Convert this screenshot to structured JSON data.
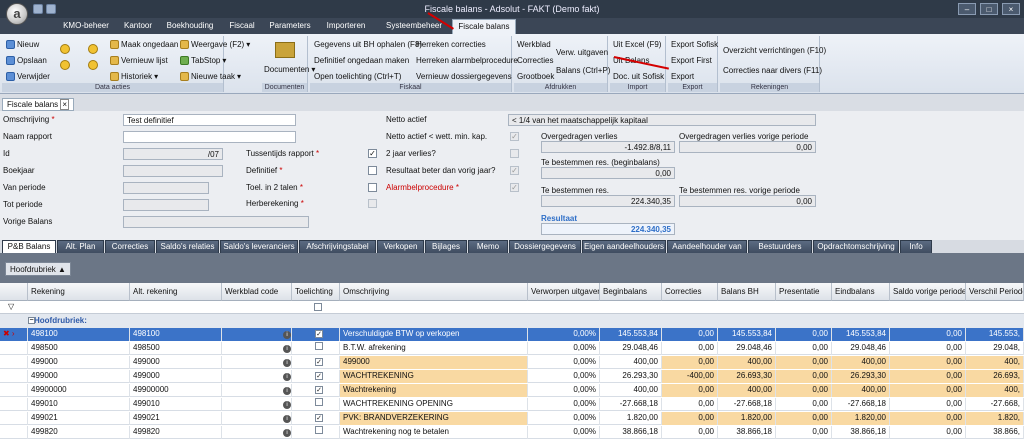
{
  "window": {
    "title": "Fiscale balans - Adsolut - FAKT (Demo fakt)"
  },
  "menu_tabs": [
    "KMO-beheer",
    "Kantoor",
    "Boekhouding",
    "Fiscaal",
    "Parameters",
    "Importeren",
    "Systeembeheer",
    "Fiscale balans"
  ],
  "ribbon": {
    "data_acties": {
      "label": "Data acties",
      "nieuw": "Nieuw",
      "opslaan": "Opslaan",
      "verwijder": "Verwijder",
      "maak_ongedaan": "Maak ongedaan",
      "vernieuw_lijst": "Vernieuw lijst",
      "historiek": "Historiek",
      "weergave": "Weergave (F2)",
      "tabstop": "TabStop",
      "nieuwe_taak": "Nieuwe taak"
    },
    "documenten": {
      "label": "Documenten",
      "btn": "Documenten"
    },
    "fiskaal": {
      "label": "Fiskaal",
      "gegevens": "Gegevens uit BH ophalen (F8)",
      "definitief": "Definitief ongedaan maken",
      "toelichting": "Open toelichting (Ctrl+T)",
      "herreken_correcties": "Herreken correcties",
      "herreken_alarm": "Herreken alarmbelprocedure",
      "vernieuw_dossier": "Vernieuw dossiergegevens"
    },
    "afdrukken": {
      "label": "Afdrukken",
      "werkblad": "Werkblad",
      "correcties": "Correcties",
      "grootboek": "Grootboek",
      "verw_uitgaven": "Verw. uitgaven",
      "balans": "Balans (Ctrl+P)"
    },
    "import": {
      "label": "Import",
      "uit_excel": "Uit Excel (F9)",
      "uit_balans": "Uit Balans",
      "doc_uit_sofisk": "Doc. uit Sofisk"
    },
    "export": {
      "label": "Export",
      "export_sofisk": "Export Sofisk",
      "export_first": "Export First",
      "export": "Export"
    },
    "rekeningen": {
      "label": "Rekeningen",
      "overzicht": "Overzicht verrichtingen (F10)",
      "correcties_divers": "Correcties naar divers (F11)"
    }
  },
  "doc_tab": {
    "label": "Fiscale balans",
    "close": "×"
  },
  "form": {
    "omschrijving_label": "Omschrijving",
    "omschrijving_value": "Test definitief",
    "naam_rapport_label": "Naam rapport",
    "naam_rapport_value": "",
    "id_label": "Id",
    "id_value": "/07",
    "boekjaar_label": "Boekjaar",
    "van_periode_label": "Van periode",
    "tot_periode_label": "Tot periode",
    "vorige_balans_label": "Vorige Balans",
    "tussentijds_label": "Tussentijds rapport",
    "definitief_label": "Definitief",
    "toel_label": "Toel. in 2 talen",
    "herberekening_label": "Herberekening",
    "netto_actief_label": "Netto actief",
    "netto_actief_value": "< 1/4 van het maatschappelijk kapitaal",
    "netto_kap_label": "Netto actief < wett. min. kap.",
    "twee_jaar_label": "2 jaar verlies?",
    "resultaat_beter_label": "Resultaat beter dan vorig jaar?",
    "alarm_label": "Alarmbelprocedure",
    "overgedragen_label": "Overgedragen verlies",
    "overgedragen_value": "-1.492.8/8,11",
    "overgedragen_vorige_label": "Overgedragen verlies vorige periode",
    "overgedragen_vorige_value": "0,00",
    "tebest_begin_label": "Te bestemmen res. (beginbalans)",
    "tebest_begin_value": "0,00",
    "tebest_label": "Te bestemmen res.",
    "tebest_value": "224.340,35",
    "tebest_vorige_label": "Te bestemmen res. vorige periode",
    "tebest_vorige_value": "0,00",
    "resultaat_label": "Resultaat",
    "resultaat_value": "224.340,35"
  },
  "bottom_tabs": [
    "P&B Balans",
    "Alt. Plan",
    "Correcties",
    "Saldo's relaties",
    "Saldo's leveranciers",
    "Afschrijvingstabel",
    "Verkopen",
    "Bijlages",
    "Memo",
    "Dossiergegevens",
    "Eigen aandeelhouders",
    "Aandeelhouder van",
    "Bestuurders",
    "Opdrachtomschrijving",
    "Info"
  ],
  "grid": {
    "group_chip": "Hoofdrubriek",
    "columns": [
      "Rekening",
      "Alt. rekening",
      "Werkblad code",
      "Toelichting",
      "Omschrijving",
      "Verworpen uitgaven",
      "Beginbalans",
      "Correcties",
      "Balans BH",
      "Presentatie",
      "Eindbalans",
      "Saldo vorige periode",
      "Verschil Periodes"
    ],
    "group_row": "Hoofdrubriek:",
    "rows": [
      {
        "rek": "498100",
        "alt": "498100",
        "toel": "✓",
        "oms": "Verschuldigde BTW op verkopen",
        "verw": "0,00%",
        "begin": "145.553,84",
        "corr": "0,00",
        "bh": "145.553,84",
        "pres": "0,00",
        "eind": "145.553,84",
        "vorig": "0,00",
        "versch": "145.553,"
      },
      {
        "rek": "498500",
        "alt": "498500",
        "toel": "",
        "oms": "B.T.W. afrekening",
        "verw": "0,00%",
        "begin": "29.048,46",
        "corr": "0,00",
        "bh": "29.048,46",
        "pres": "0,00",
        "eind": "29.048,46",
        "vorig": "0,00",
        "versch": "29.048,"
      },
      {
        "rek": "499000",
        "alt": "499000",
        "toel": "✓",
        "oms": "499000",
        "verw": "0,00%",
        "begin": "400,00",
        "corr": "0,00",
        "bh": "400,00",
        "pres": "0,00",
        "eind": "400,00",
        "vorig": "0,00",
        "versch": "400,"
      },
      {
        "rek": "499000",
        "alt": "499000",
        "toel": "✓",
        "oms": "WACHTREKENING",
        "verw": "0,00%",
        "begin": "26.293,30",
        "corr": "-400,00",
        "bh": "26.693,30",
        "pres": "0,00",
        "eind": "26.293,30",
        "vorig": "0,00",
        "versch": "26.693,"
      },
      {
        "rek": "49900000",
        "alt": "49900000",
        "toel": "✓",
        "oms": "Wachtrekening",
        "verw": "0,00%",
        "begin": "400,00",
        "corr": "0,00",
        "bh": "400,00",
        "pres": "0,00",
        "eind": "400,00",
        "vorig": "0,00",
        "versch": "400,"
      },
      {
        "rek": "499010",
        "alt": "499010",
        "toel": "",
        "oms": "WACHTREKENING OPENING",
        "verw": "0,00%",
        "begin": "-27.668,18",
        "corr": "0,00",
        "bh": "-27.668,18",
        "pres": "0,00",
        "eind": "-27.668,18",
        "vorig": "0,00",
        "versch": "-27.668,"
      },
      {
        "rek": "499021",
        "alt": "499021",
        "toel": "✓",
        "oms": "PVK: BRANDVERZEKERING",
        "verw": "0,00%",
        "begin": "1.820,00",
        "corr": "0,00",
        "bh": "1.820,00",
        "pres": "0,00",
        "eind": "1.820,00",
        "vorig": "0,00",
        "versch": "1.820,"
      },
      {
        "rek": "499820",
        "alt": "499820",
        "toel": "",
        "oms": "Wachtrekening nog te betalen",
        "verw": "0,00%",
        "begin": "38.866,18",
        "corr": "0,00",
        "bh": "38.866,18",
        "pres": "0,00",
        "eind": "38.866,18",
        "vorig": "0,00",
        "versch": "38.866,"
      }
    ]
  },
  "colors": {
    "accent": "#3b73c8",
    "highlight": "#f9d9a2",
    "arrow": "#d40000"
  }
}
